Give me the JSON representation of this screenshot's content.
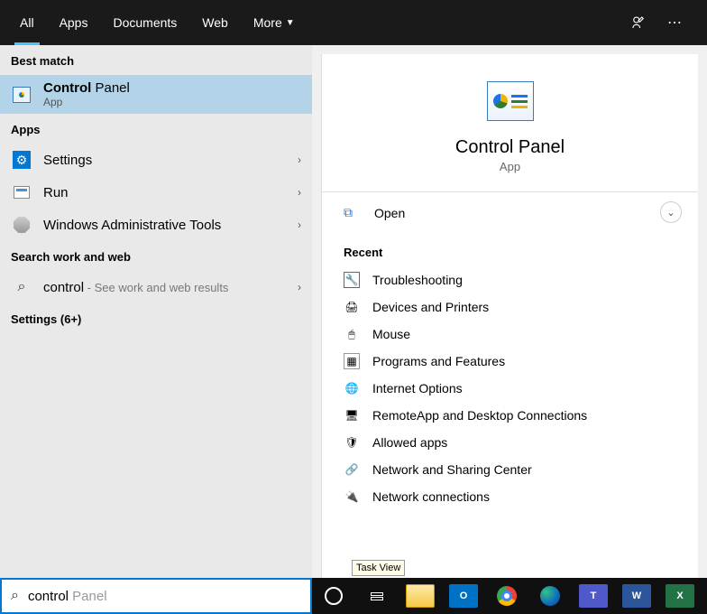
{
  "header": {
    "tabs": [
      "All",
      "Apps",
      "Documents",
      "Web",
      "More"
    ]
  },
  "left": {
    "best_match_label": "Best match",
    "selected": {
      "title_match": "Control",
      "title_rest": " Panel",
      "subtitle": "App"
    },
    "apps_label": "Apps",
    "apps": [
      {
        "name": "Settings"
      },
      {
        "name": "Run"
      },
      {
        "name": "Windows Administrative Tools"
      }
    ],
    "web_label": "Search work and web",
    "web_query": "control",
    "web_hint": " - See work and web results",
    "settings_more": "Settings (6+)"
  },
  "right": {
    "title": "Control Panel",
    "subtitle": "App",
    "open_label": "Open",
    "recent_label": "Recent",
    "recent": [
      "Troubleshooting",
      "Devices and Printers",
      "Mouse",
      "Programs and Features",
      "Internet Options",
      "RemoteApp and Desktop Connections",
      "Allowed apps",
      "Network and Sharing Center",
      "Network connections"
    ]
  },
  "tooltip": "Task View",
  "search": {
    "typed": "control",
    "ghost": " Panel"
  }
}
